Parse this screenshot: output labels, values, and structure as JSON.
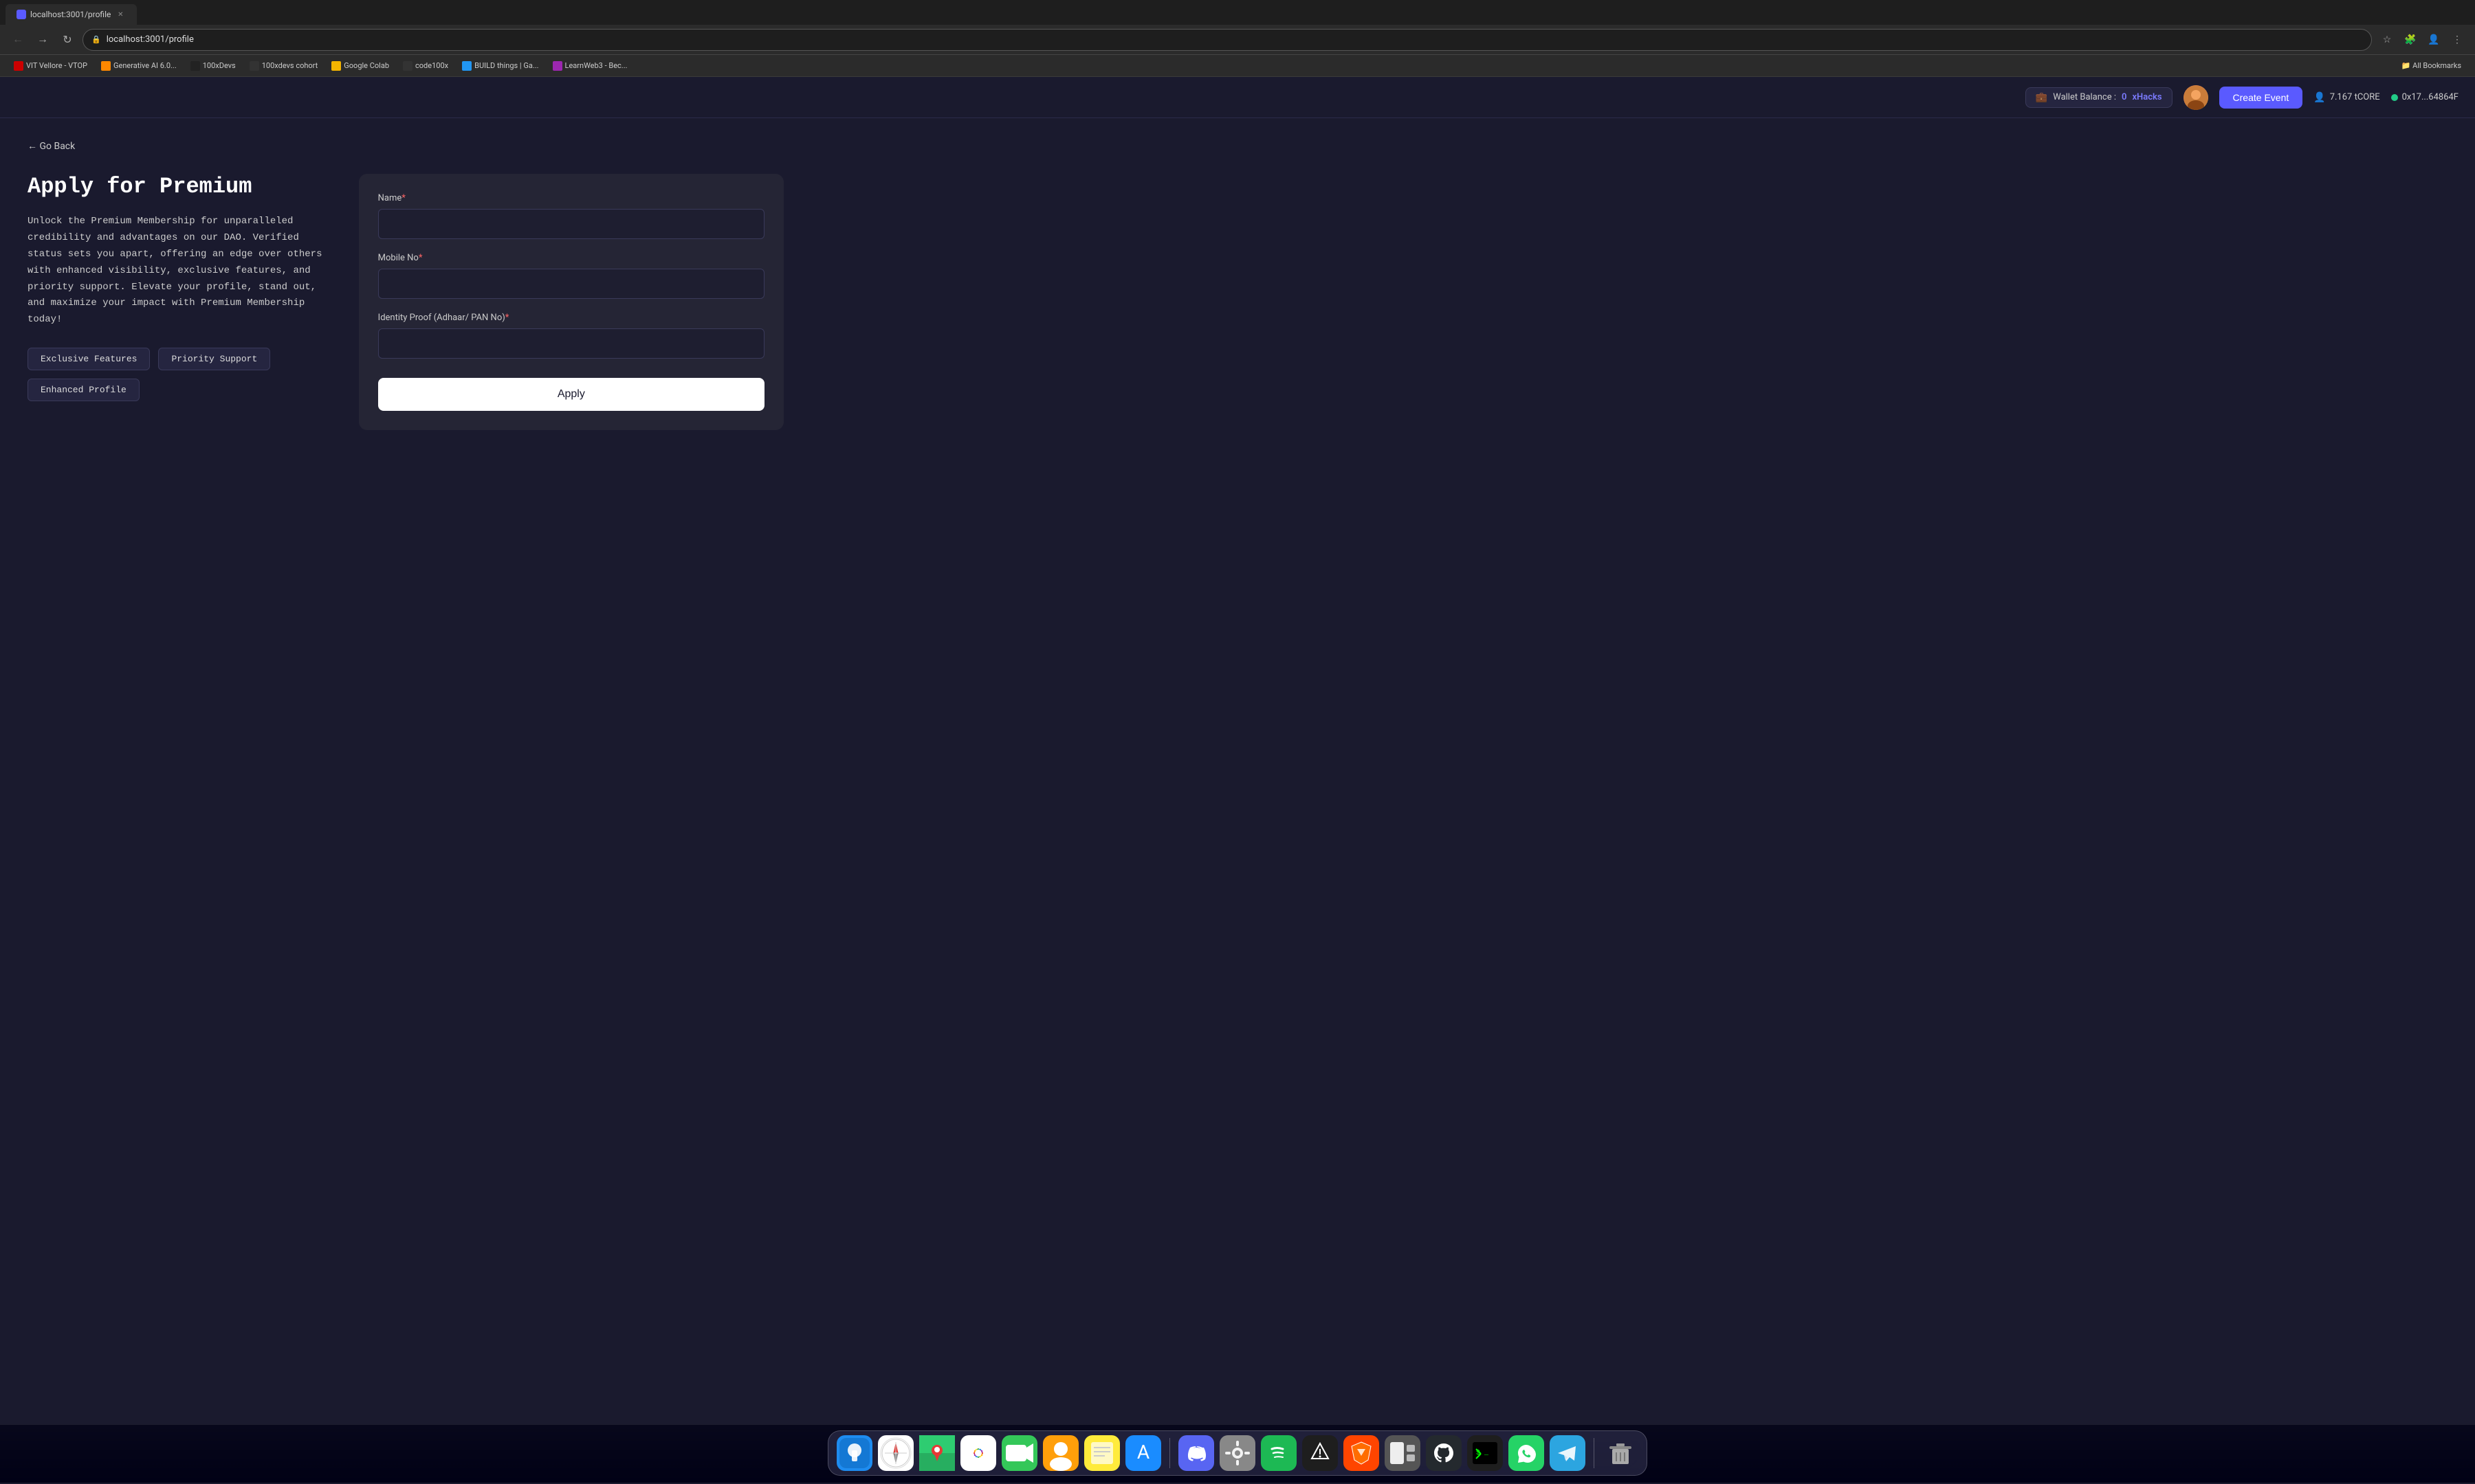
{
  "browser": {
    "tab_title": "localhost:3001/profile",
    "url": "localhost:3001/profile",
    "back_btn": "←",
    "forward_btn": "→",
    "refresh_btn": "↻",
    "star_btn": "☆"
  },
  "bookmarks": [
    {
      "label": "VIT Vellore - VTOP",
      "color": "#cc0000"
    },
    {
      "label": "Generative AI 6.0...",
      "color": "#ff8800"
    },
    {
      "label": "100xDevs",
      "color": "#333"
    },
    {
      "label": "100xdevs cohort",
      "color": "#444"
    },
    {
      "label": "Google Colab",
      "color": "#f4b400"
    },
    {
      "label": "code100x",
      "color": "#333"
    },
    {
      "label": "BUILD things | Ga...",
      "color": "#2196f3"
    },
    {
      "label": "LearnWeb3 - Bec...",
      "color": "#9c27b0"
    },
    {
      "label": "All Bookmarks",
      "color": "#aaa"
    }
  ],
  "header": {
    "wallet_label": "Wallet Balance :",
    "wallet_amount": "0",
    "wallet_currency": "xHacks",
    "create_event_label": "Create Event",
    "tcore_amount": "7.167 tCORE",
    "wallet_address": "0x17...64864F"
  },
  "page": {
    "go_back_label": "← Go Back",
    "title": "Apply for Premium",
    "description": "Unlock the Premium Membership for unparalleled credibility and advantages on our DAO. Verified status sets you apart, offering an edge over others with enhanced visibility, exclusive features, and priority support. Elevate your profile, stand out, and maximize your impact with Premium Membership today!",
    "badges": [
      {
        "label": "Exclusive Features"
      },
      {
        "label": "Priority Support"
      },
      {
        "label": "Enhanced Profile"
      }
    ]
  },
  "form": {
    "name_label": "Name",
    "name_required": "*",
    "name_placeholder": "",
    "mobile_label": "Mobile No",
    "mobile_required": "*",
    "mobile_placeholder": "",
    "identity_label": "Identity Proof (Adhaar/ PAN No)",
    "identity_required": "*",
    "identity_placeholder": "",
    "apply_btn": "Apply"
  },
  "dock": [
    {
      "icon": "🔵",
      "name": "finder"
    },
    {
      "icon": "🧭",
      "name": "safari"
    },
    {
      "icon": "🗺️",
      "name": "maps"
    },
    {
      "icon": "📷",
      "name": "photos"
    },
    {
      "icon": "📹",
      "name": "facetime"
    },
    {
      "icon": "🟡",
      "name": "contacts"
    },
    {
      "icon": "📝",
      "name": "notes"
    },
    {
      "icon": "📱",
      "name": "appstore"
    },
    {
      "icon": "🔵",
      "name": "discord"
    },
    {
      "icon": "⚙️",
      "name": "settings"
    },
    {
      "icon": "🟢",
      "name": "spotify"
    },
    {
      "icon": "🖤",
      "name": "clearance"
    },
    {
      "icon": "🦁",
      "name": "brave"
    },
    {
      "icon": "⬜",
      "name": "stage"
    },
    {
      "icon": "🐙",
      "name": "github"
    },
    {
      "icon": "🖥️",
      "name": "terminal"
    },
    {
      "icon": "📞",
      "name": "whatsapp"
    },
    {
      "icon": "✈️",
      "name": "telegram"
    },
    {
      "icon": "🗑️",
      "name": "trash"
    }
  ]
}
